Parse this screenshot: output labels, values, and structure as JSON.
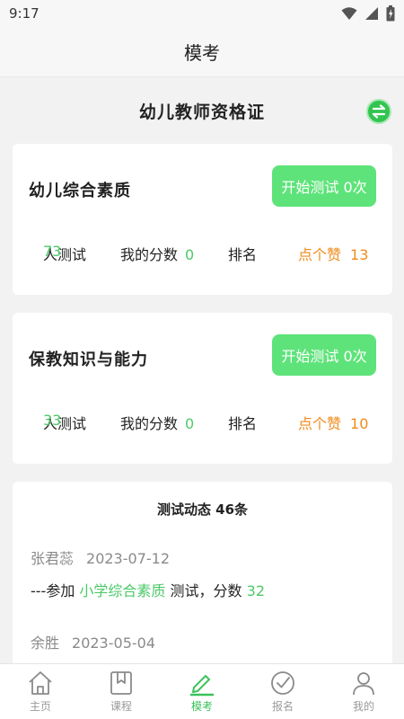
{
  "status_bar": {
    "time": "9:17"
  },
  "header": {
    "title": "模考"
  },
  "certificate": {
    "title": "幼儿教师资格证"
  },
  "exams": [
    {
      "name": "幼儿综合素质",
      "button_label": "开始测试 0次",
      "people_count": "73",
      "people_suffix": "人测试",
      "score_label": "我的分数",
      "score_value": "0",
      "rank_label": "排名",
      "like_label": "点个赞",
      "like_count": "13"
    },
    {
      "name": "保教知识与能力",
      "button_label": "开始测试 0次",
      "people_count": "33",
      "people_suffix": "人测试",
      "score_label": "我的分数",
      "score_value": "0",
      "rank_label": "排名",
      "like_label": "点个赞",
      "like_count": "10"
    }
  ],
  "activity": {
    "title": "测试动态 46条",
    "items": [
      {
        "user": "张君蕊",
        "date": "2023-07-12",
        "prefix": "---参加",
        "subject": "小学综合素质",
        "middle": "测试，分数",
        "score": "32"
      },
      {
        "user": "余胜",
        "date": "2023-05-04"
      }
    ]
  },
  "tabs": [
    {
      "label": "主页",
      "icon": "home-icon"
    },
    {
      "label": "课程",
      "icon": "bookmark-icon"
    },
    {
      "label": "模考",
      "icon": "pencil-icon",
      "active": true
    },
    {
      "label": "报名",
      "icon": "check-circle-icon"
    },
    {
      "label": "我的",
      "icon": "person-icon"
    }
  ],
  "colors": {
    "accent_green": "#4cc968",
    "button_green": "#5ee37a",
    "like_orange": "#f08a1a"
  }
}
